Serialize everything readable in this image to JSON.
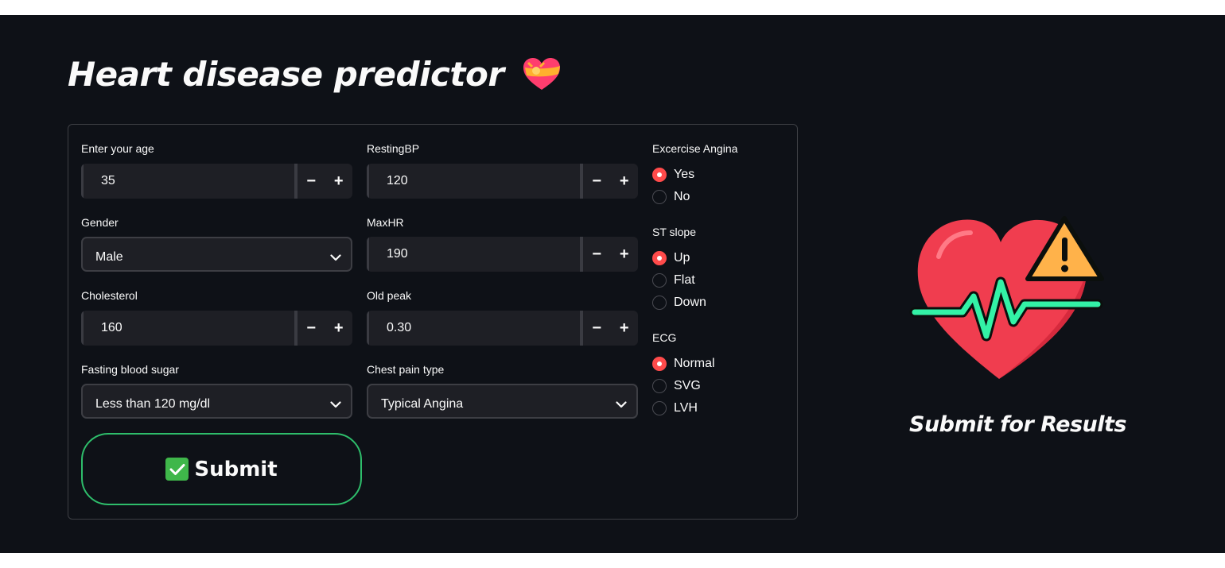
{
  "app": {
    "title": "Heart disease predictor",
    "title_emoji": "heart-with-ribbon-icon",
    "accent_color": "#ff4b4b",
    "submit_border_color": "#2ebd6b"
  },
  "form": {
    "age": {
      "label": "Enter your age",
      "value": "35"
    },
    "resting_bp": {
      "label": "RestingBP",
      "value": "120"
    },
    "gender": {
      "label": "Gender",
      "value": "Male"
    },
    "max_hr": {
      "label": "MaxHR",
      "value": "190"
    },
    "cholesterol": {
      "label": "Cholesterol",
      "value": "160"
    },
    "old_peak": {
      "label": "Old peak",
      "value": "0.30"
    },
    "fasting_blood_sugar": {
      "label": "Fasting blood sugar",
      "value": "Less than 120 mg/dl"
    },
    "chest_pain_type": {
      "label": "Chest pain type",
      "value": "Typical Angina"
    },
    "stepper": {
      "minus": "−",
      "plus": "+"
    },
    "exercise_angina": {
      "label": "Excercise Angina",
      "options": [
        {
          "label": "Yes",
          "selected": true
        },
        {
          "label": "No",
          "selected": false
        }
      ]
    },
    "st_slope": {
      "label": "ST slope",
      "options": [
        {
          "label": "Up",
          "selected": true
        },
        {
          "label": "Flat",
          "selected": false
        },
        {
          "label": "Down",
          "selected": false
        }
      ]
    },
    "ecg": {
      "label": "ECG",
      "options": [
        {
          "label": "Normal",
          "selected": true
        },
        {
          "label": "SVG",
          "selected": false
        },
        {
          "label": "LVH",
          "selected": false
        }
      ]
    },
    "submit": {
      "label": "Submit",
      "icon": "check-mark-icon"
    }
  },
  "result": {
    "image": "heart-warning-icon",
    "text": "Submit for Results"
  }
}
